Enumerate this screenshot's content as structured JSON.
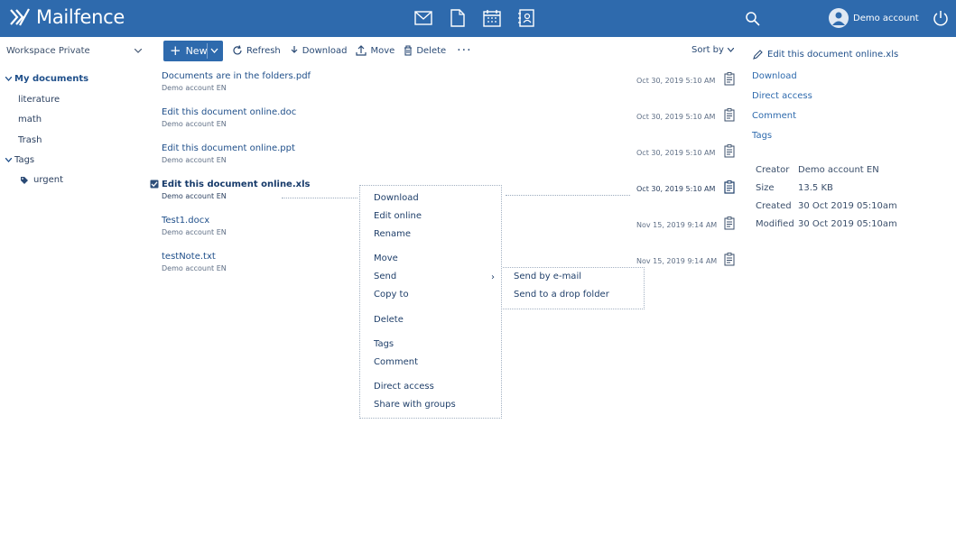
{
  "app": {
    "name": "Mailfence"
  },
  "topbar": {
    "icons": [
      "mail-icon",
      "document-icon",
      "calendar-icon",
      "contacts-icon"
    ],
    "account_name": "Demo account"
  },
  "sidebar": {
    "workspace": "Workspace Private",
    "my_documents": "My documents",
    "folders": [
      "literature",
      "math",
      "Trash"
    ],
    "tags_label": "Tags",
    "tags": [
      "urgent"
    ]
  },
  "toolbar": {
    "new_label": "New",
    "refresh_label": "Refresh",
    "download_label": "Download",
    "move_label": "Move",
    "delete_label": "Delete",
    "more_label": "···",
    "sort_label": "Sort by"
  },
  "files": [
    {
      "name": "Documents are in the folders.pdf",
      "owner": "Demo account EN",
      "date": "Oct 30, 2019 5:10 AM"
    },
    {
      "name": "Edit this document online.doc",
      "owner": "Demo account EN",
      "date": "Oct 30, 2019 5:10 AM"
    },
    {
      "name": "Edit this document online.ppt",
      "owner": "Demo account EN",
      "date": "Oct 30, 2019 5:10 AM"
    },
    {
      "name": "Edit this document online.xls",
      "owner": "Demo account EN",
      "date": "Oct 30, 2019 5:10 AM"
    },
    {
      "name": "Test1.docx",
      "owner": "Demo account EN",
      "date": "Nov 15, 2019 9:14 AM"
    },
    {
      "name": "testNote.txt",
      "owner": "Demo account EN",
      "date": "Nov 15, 2019 9:14 AM"
    }
  ],
  "context_menu": {
    "download": "Download",
    "edit_online": "Edit online",
    "rename": "Rename",
    "move": "Move",
    "send": "Send",
    "copy_to": "Copy to",
    "delete": "Delete",
    "tags": "Tags",
    "comment": "Comment",
    "direct_access": "Direct access",
    "share_with_groups": "Share with groups",
    "submenu_arrow": "›"
  },
  "send_submenu": {
    "send_by_email": "Send by e-mail",
    "send_to_drop_folder": "Send to a drop folder"
  },
  "details": {
    "title": "Edit this document online.xls",
    "download": "Download",
    "direct_access": "Direct access",
    "comment": "Comment",
    "tags": "Tags",
    "creator_label": "Creator",
    "creator_value": "Demo account EN",
    "size_label": "Size",
    "size_value": "13.5 KB",
    "created_label": "Created",
    "created_value": "30 Oct 2019 05:10am",
    "modified_label": "Modified",
    "modified_value": "30 Oct 2019 05:10am"
  },
  "colors": {
    "brand": "#2e6aad",
    "link": "#1f4f8a"
  }
}
